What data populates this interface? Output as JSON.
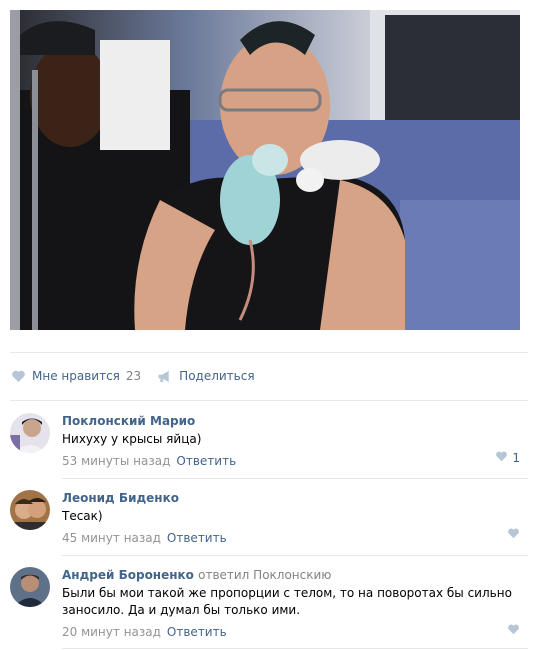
{
  "post": {
    "photo_alt": ""
  },
  "actions": {
    "like_label": "Мне нравится",
    "like_count": "23",
    "share_label": "Поделиться"
  },
  "comments": [
    {
      "author": "Поклонский Марио",
      "replied_to": "",
      "text": "Нихуху у крысы яйца)",
      "time": "53 минуты назад",
      "reply_label": "Ответить",
      "likes": "1"
    },
    {
      "author": "Леонид Биденко",
      "replied_to": "",
      "text": "Тесак)",
      "time": "45 минут назад",
      "reply_label": "Ответить",
      "likes": ""
    },
    {
      "author": "Андрей Бороненко",
      "replied_to": "ответил Поклонскию",
      "text": "Были бы мои такой же пропорции с телом, то на поворотах бы сильно заносило. Да и думал бы только ими.",
      "time": "20 минут назад",
      "reply_label": "Ответить",
      "likes": ""
    }
  ],
  "colors": {
    "link": "#42648b",
    "muted": "#939393",
    "icon": "#b7c6d6",
    "divider": "#e7e8ec"
  },
  "icons": {
    "like": "heart-icon",
    "share": "megaphone-icon"
  }
}
